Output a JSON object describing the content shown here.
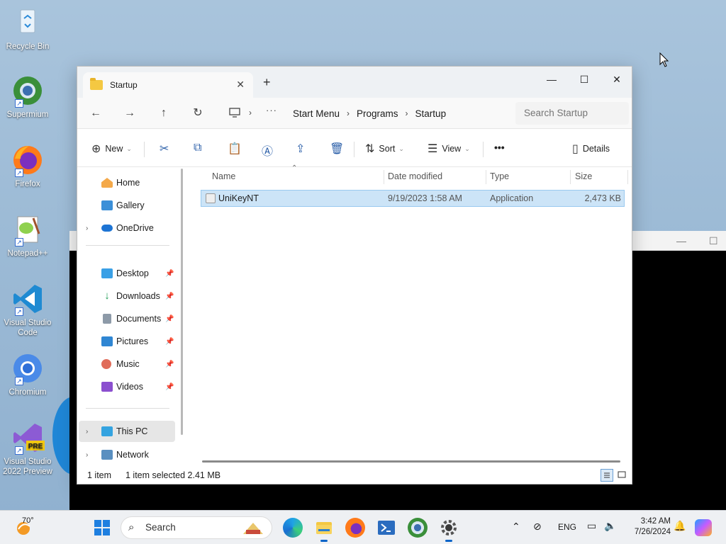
{
  "desktop": {
    "icons": [
      {
        "label": "Recycle Bin",
        "icon": "recycle-bin-icon"
      },
      {
        "label": "Supermium",
        "icon": "supermium-icon"
      },
      {
        "label": "Firefox",
        "icon": "firefox-icon"
      },
      {
        "label": "Notepad++",
        "icon": "notepad-plus-plus-icon"
      },
      {
        "label": "Visual Studio Code",
        "icon": "vscode-icon"
      },
      {
        "label": "Chromium",
        "icon": "chromium-icon"
      },
      {
        "label": "Visual Studio 2022 Preview",
        "icon": "visual-studio-icon",
        "badge": "PRE"
      }
    ]
  },
  "explorer": {
    "tab_title": "Startup",
    "window_controls": {
      "minimize": "—",
      "maximize": "☐",
      "close": "✕"
    },
    "breadcrumb": [
      "Start Menu",
      "Programs",
      "Startup"
    ],
    "search_placeholder": "Search Startup",
    "toolbar": {
      "new": "New",
      "sort": "Sort",
      "view": "View",
      "more": "•••",
      "details": "Details"
    },
    "nav": {
      "home": "Home",
      "gallery": "Gallery",
      "onedrive": "OneDrive",
      "desktop": "Desktop",
      "downloads": "Downloads",
      "documents": "Documents",
      "pictures": "Pictures",
      "music": "Music",
      "videos": "Videos",
      "thispc": "This PC",
      "network": "Network"
    },
    "columns": {
      "name": "Name",
      "date": "Date modified",
      "type": "Type",
      "size": "Size"
    },
    "files": [
      {
        "name": "UniKeyNT",
        "date": "9/19/2023 1:58 AM",
        "type": "Application",
        "size": "2,473 KB"
      }
    ],
    "status": {
      "count": "1 item",
      "selected": "1 item selected  2.41 MB"
    }
  },
  "taskbar": {
    "weather_temp": "70°",
    "search_label": "Search",
    "language": "ENG",
    "time": "3:42 AM",
    "date": "7/26/2024"
  }
}
